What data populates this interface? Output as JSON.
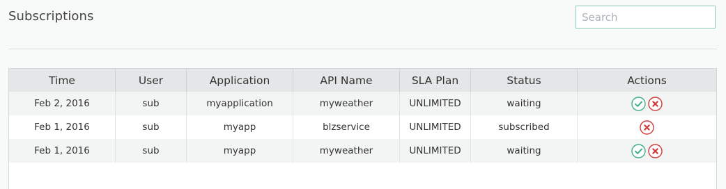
{
  "header": {
    "title": "Subscriptions"
  },
  "search": {
    "placeholder": "Search",
    "value": ""
  },
  "table": {
    "columns": [
      "Time",
      "User",
      "Application",
      "API Name",
      "SLA Plan",
      "Status",
      "Actions"
    ],
    "rows": [
      {
        "time": "Feb 2, 2016",
        "user": "sub",
        "application": "myapplication",
        "api_name": "myweather",
        "sla_plan": "UNLIMITED",
        "status": "waiting",
        "actions": [
          "approve-icon",
          "reject-icon"
        ]
      },
      {
        "time": "Feb 1, 2016",
        "user": "sub",
        "application": "myapp",
        "api_name": "blzservice",
        "sla_plan": "UNLIMITED",
        "status": "subscribed",
        "actions": [
          "reject-icon"
        ]
      },
      {
        "time": "Feb 1, 2016",
        "user": "sub",
        "application": "myapp",
        "api_name": "myweather",
        "sla_plan": "UNLIMITED",
        "status": "waiting",
        "actions": [
          "approve-icon",
          "reject-icon"
        ]
      }
    ]
  },
  "colors": {
    "approve": "#3fae8a",
    "reject": "#d23a3a",
    "search_border": "#8fcbb4"
  }
}
